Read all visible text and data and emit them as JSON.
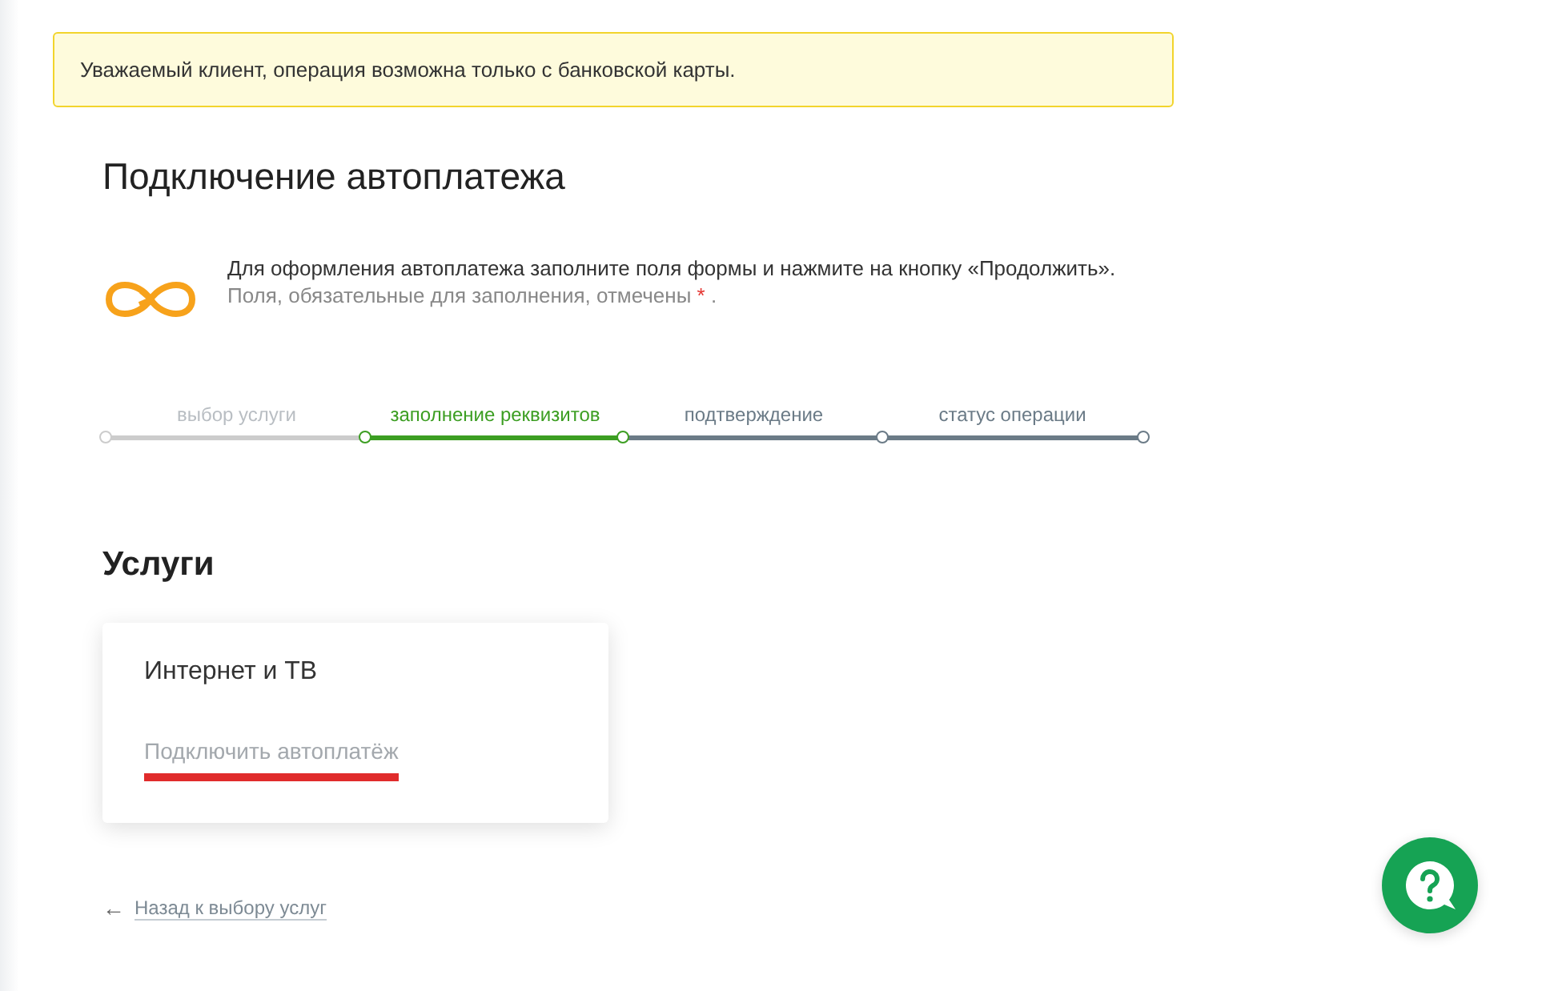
{
  "alert": {
    "text": "Уважаемый клиент, операция возможна только с банковской карты."
  },
  "title": "Подключение автоплатежа",
  "info": {
    "text": "Для оформления автоплатежа заполните поля формы и нажмите на кнопку «Продолжить».",
    "note": "Поля, обязательные для заполнения, отмечены",
    "required_mark": "*",
    "note_end": "."
  },
  "steps": [
    {
      "label": "выбор услуги",
      "completed": true,
      "selected": false
    },
    {
      "label": "заполнение реквизитов",
      "completed": false,
      "selected": true
    },
    {
      "label": "подтверждение",
      "completed": false,
      "selected": false
    },
    {
      "label": "статус операции",
      "completed": false,
      "selected": false
    }
  ],
  "section_title": "Услуги",
  "services": [
    {
      "name": "Интернет и ТВ",
      "action": "Подключить автоплатёж"
    }
  ],
  "back_link": {
    "arrow": "←",
    "text": "Назад к выбору услуг"
  }
}
